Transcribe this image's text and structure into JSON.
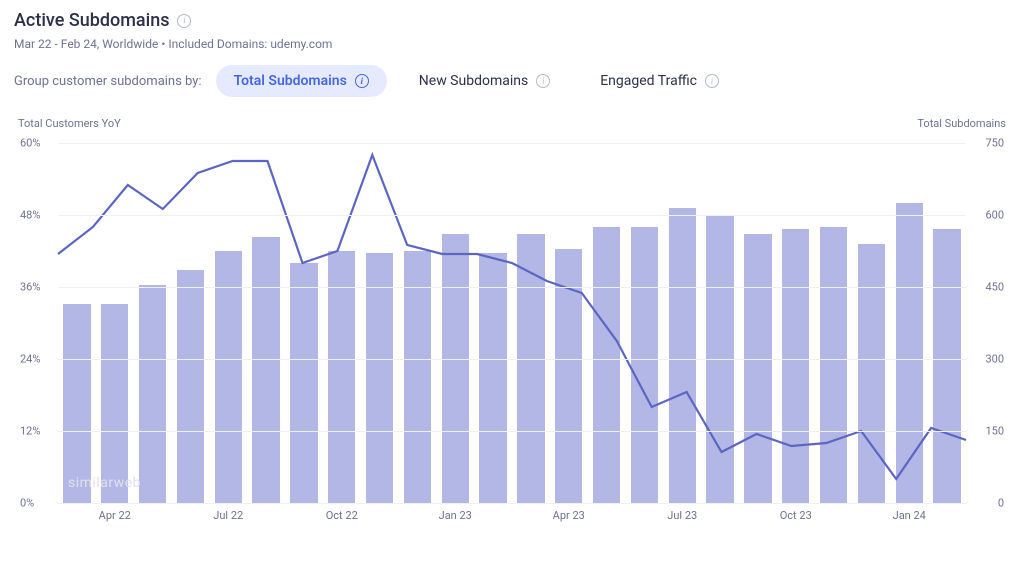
{
  "header": {
    "title": "Active Subdomains",
    "subtitle": "Mar 22 - Feb 24, Worldwide • Included Domains: udemy.com"
  },
  "controls": {
    "label": "Group customer subdomains by:",
    "chips": [
      {
        "label": "Total Subdomains",
        "active": true
      },
      {
        "label": "New Subdomains",
        "active": false
      },
      {
        "label": "Engaged Traffic",
        "active": false
      }
    ]
  },
  "axis_left_title": "Total Customers YoY",
  "axis_right_title": "Total Subdomains",
  "watermark": "similarweb",
  "chart_data": {
    "type": "bar+line",
    "categories": [
      "Mar 22",
      "Apr 22",
      "May 22",
      "Jun 22",
      "Jul 22",
      "Aug 22",
      "Sep 22",
      "Oct 22",
      "Nov 22",
      "Dec 22",
      "Jan 23",
      "Feb 23",
      "Mar 23",
      "Apr 23",
      "May 23",
      "Jun 23",
      "Jul 23",
      "Aug 23",
      "Sep 23",
      "Oct 23",
      "Nov 23",
      "Dec 23",
      "Jan 24",
      "Feb 24"
    ],
    "x_tick_labels": [
      "Apr 22",
      "Jul 22",
      "Oct 22",
      "Jan 23",
      "Apr 23",
      "Jul 23",
      "Oct 23",
      "Jan 24"
    ],
    "x_tick_indices": [
      1,
      4,
      7,
      10,
      13,
      16,
      19,
      22
    ],
    "left_axis": {
      "ticks": [
        0,
        12,
        24,
        36,
        48,
        60
      ],
      "fmt": "percent",
      "range": [
        0,
        60
      ]
    },
    "right_axis": {
      "ticks": [
        0,
        150,
        300,
        450,
        600,
        750
      ],
      "range": [
        0,
        750
      ]
    },
    "series": [
      {
        "name": "Total Subdomains",
        "kind": "bar",
        "axis": "right",
        "values": [
          415,
          415,
          455,
          485,
          525,
          555,
          500,
          525,
          520,
          525,
          560,
          520,
          560,
          530,
          575,
          575,
          615,
          600,
          560,
          570,
          575,
          540,
          625,
          570
        ]
      },
      {
        "name": "Total Customers YoY",
        "kind": "line",
        "axis": "left",
        "values": [
          41.5,
          46,
          53,
          49,
          55,
          57,
          57,
          40,
          42,
          58,
          43,
          41.5,
          41.5,
          40,
          37,
          35,
          27,
          16,
          18.5,
          8.5,
          11.5,
          9.5,
          10,
          12,
          4,
          12.5,
          10.5
        ]
      }
    ]
  }
}
